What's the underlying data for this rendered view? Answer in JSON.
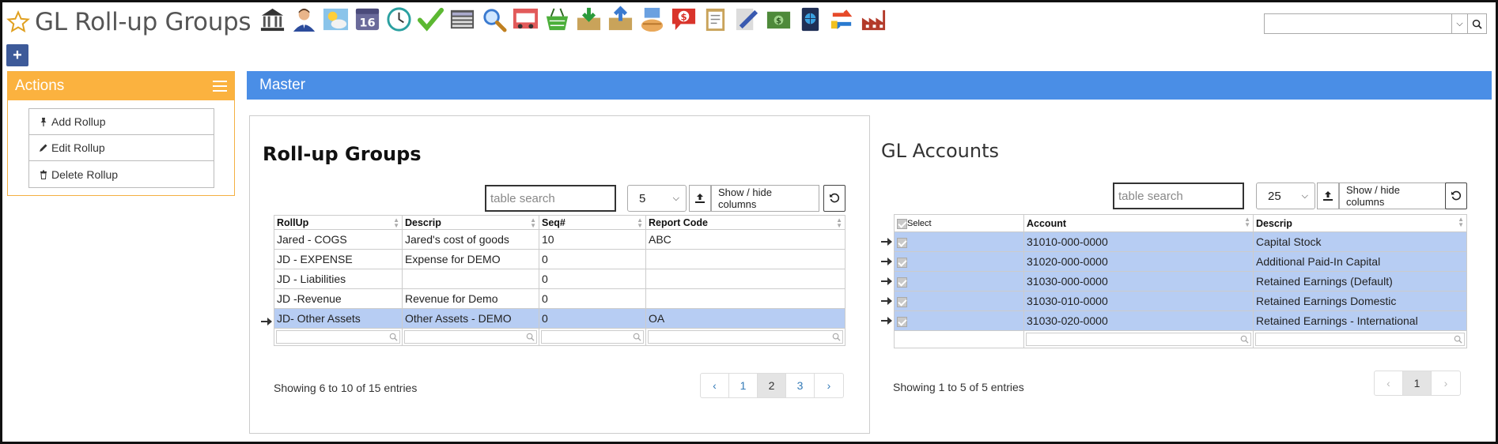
{
  "header": {
    "title": "GL Roll-up Groups"
  },
  "toolbar": {
    "icons": [
      "bank-icon",
      "user-icon",
      "weather-icon",
      "calendar-icon",
      "clock-icon",
      "checkmark-icon",
      "keyboard-icon",
      "magnifier-icon",
      "truck-icon",
      "basket-icon",
      "download-box-icon",
      "upload-box-icon",
      "payment-hand-icon",
      "dollar-chat-icon",
      "clipboard-icon",
      "pencil-doc-icon",
      "money-icon",
      "passport-icon",
      "exchange-icon",
      "factory-icon"
    ],
    "calendar_day": "16"
  },
  "top_search": {
    "value": ""
  },
  "sidebar": {
    "add_button": "+",
    "actions_title": "Actions",
    "actions": [
      {
        "label": "Add Rollup"
      },
      {
        "label": "Edit Rollup"
      },
      {
        "label": "Delete Rollup"
      }
    ]
  },
  "master": {
    "title": "Master"
  },
  "rollup": {
    "title": "Roll-up Groups",
    "search_placeholder": "table search",
    "page_size": "5",
    "show_hide_label": "Show / hide columns",
    "columns": [
      "RollUp",
      "Descrip",
      "Seq#",
      "Report Code"
    ],
    "rows": [
      {
        "rollup": "Jared - COGS",
        "descrip": "Jared's cost of goods",
        "seq": "10",
        "code": "ABC",
        "selected": false
      },
      {
        "rollup": "JD - EXPENSE",
        "descrip": "Expense for DEMO",
        "seq": "0",
        "code": "",
        "selected": false
      },
      {
        "rollup": "JD - Liabilities",
        "descrip": "",
        "seq": "0",
        "code": "",
        "selected": false
      },
      {
        "rollup": "JD -Revenue",
        "descrip": "Revenue for Demo",
        "seq": "0",
        "code": "",
        "selected": false
      },
      {
        "rollup": "JD- Other Assets",
        "descrip": "Other Assets - DEMO",
        "seq": "0",
        "code": "OA",
        "selected": true
      }
    ],
    "showing": "Showing 6 to 10 of 15 entries",
    "pages": [
      "‹",
      "1",
      "2",
      "3",
      "›"
    ],
    "active_page": "2"
  },
  "gl": {
    "title": "GL Accounts",
    "search_placeholder": "table search",
    "page_size": "25",
    "show_hide_label": "Show / hide columns",
    "columns": [
      "Select",
      "Account",
      "Descrip"
    ],
    "rows": [
      {
        "account": "31010-000-0000",
        "descrip": "Capital Stock"
      },
      {
        "account": "31020-000-0000",
        "descrip": "Additional Paid-In Capital"
      },
      {
        "account": "31030-000-0000",
        "descrip": "Retained Earnings (Default)"
      },
      {
        "account": "31030-010-0000",
        "descrip": "Retained Earnings Domestic"
      },
      {
        "account": "31030-020-0000",
        "descrip": "Retained Earnings - International"
      }
    ],
    "showing": "Showing 1 to 5 of 5 entries",
    "pages": [
      "‹",
      "1",
      "›"
    ],
    "active_page": "1"
  },
  "colors": {
    "actions_header": "#fbb23f",
    "master_bar": "#4a8ee6",
    "selected_row": "#b7cdf3",
    "plus_button": "#3d5a99"
  }
}
